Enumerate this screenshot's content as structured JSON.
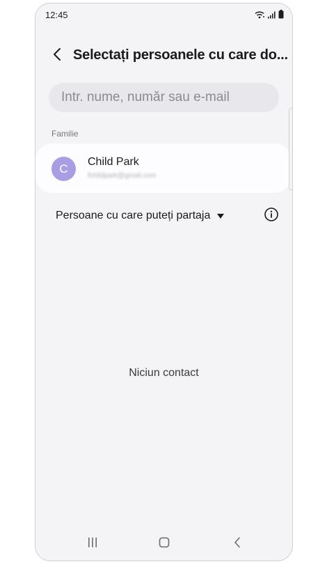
{
  "status_bar": {
    "time": "12:45",
    "icons": [
      "wifi-icon",
      "signal-icon",
      "battery-icon"
    ]
  },
  "header": {
    "back_icon": "chevron-left-icon",
    "title": "Selectați persoanele cu care do..."
  },
  "search": {
    "value": "",
    "placeholder": "Intr. nume, număr sau e-mail"
  },
  "family_section": {
    "label": "Familie",
    "contacts": [
      {
        "initial": "C",
        "name": "Child Park",
        "email": "fchildpark@gmail.com"
      }
    ]
  },
  "share_filter": {
    "label": "Persoane cu care puteți partaja",
    "dropdown_icon": "caret-down-icon",
    "info_icon": "info-icon"
  },
  "empty_state": {
    "text": "Niciun contact"
  },
  "nav_bar": {
    "buttons": [
      "recents-icon",
      "home-icon",
      "back-icon"
    ]
  },
  "colors": {
    "background": "#f4f4f6",
    "card": "#fdfdff",
    "search_bg": "#e8e8ec",
    "avatar": "#a99ee4",
    "text": "#1a1a1a"
  }
}
